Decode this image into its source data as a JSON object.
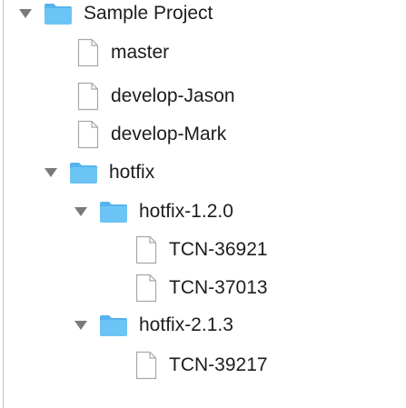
{
  "tree": {
    "root": {
      "label": "Sample Project",
      "expanded": true,
      "icon": "folder-icon"
    },
    "items": [
      {
        "label": "master",
        "icon": "file-icon"
      },
      {
        "label": "develop-Jason",
        "icon": "file-icon"
      },
      {
        "label": "develop-Mark",
        "icon": "file-icon"
      },
      {
        "label": "hotfix",
        "expanded": true,
        "icon": "folder-icon",
        "children": [
          {
            "label": "hotfix-1.2.0",
            "expanded": true,
            "icon": "folder-icon",
            "children": [
              {
                "label": "TCN-36921",
                "icon": "file-icon"
              },
              {
                "label": "TCN-37013",
                "icon": "file-icon"
              }
            ]
          },
          {
            "label": "hotfix-2.1.3",
            "expanded": true,
            "icon": "folder-icon",
            "children": [
              {
                "label": "TCN-39217",
                "icon": "file-icon"
              }
            ]
          }
        ]
      }
    ]
  },
  "colors": {
    "folder_body": "#6cc4f5",
    "folder_tab": "#56b4ec",
    "disclosure_triangle": "#7a7a7a",
    "file_outline": "#a8a8a8"
  }
}
